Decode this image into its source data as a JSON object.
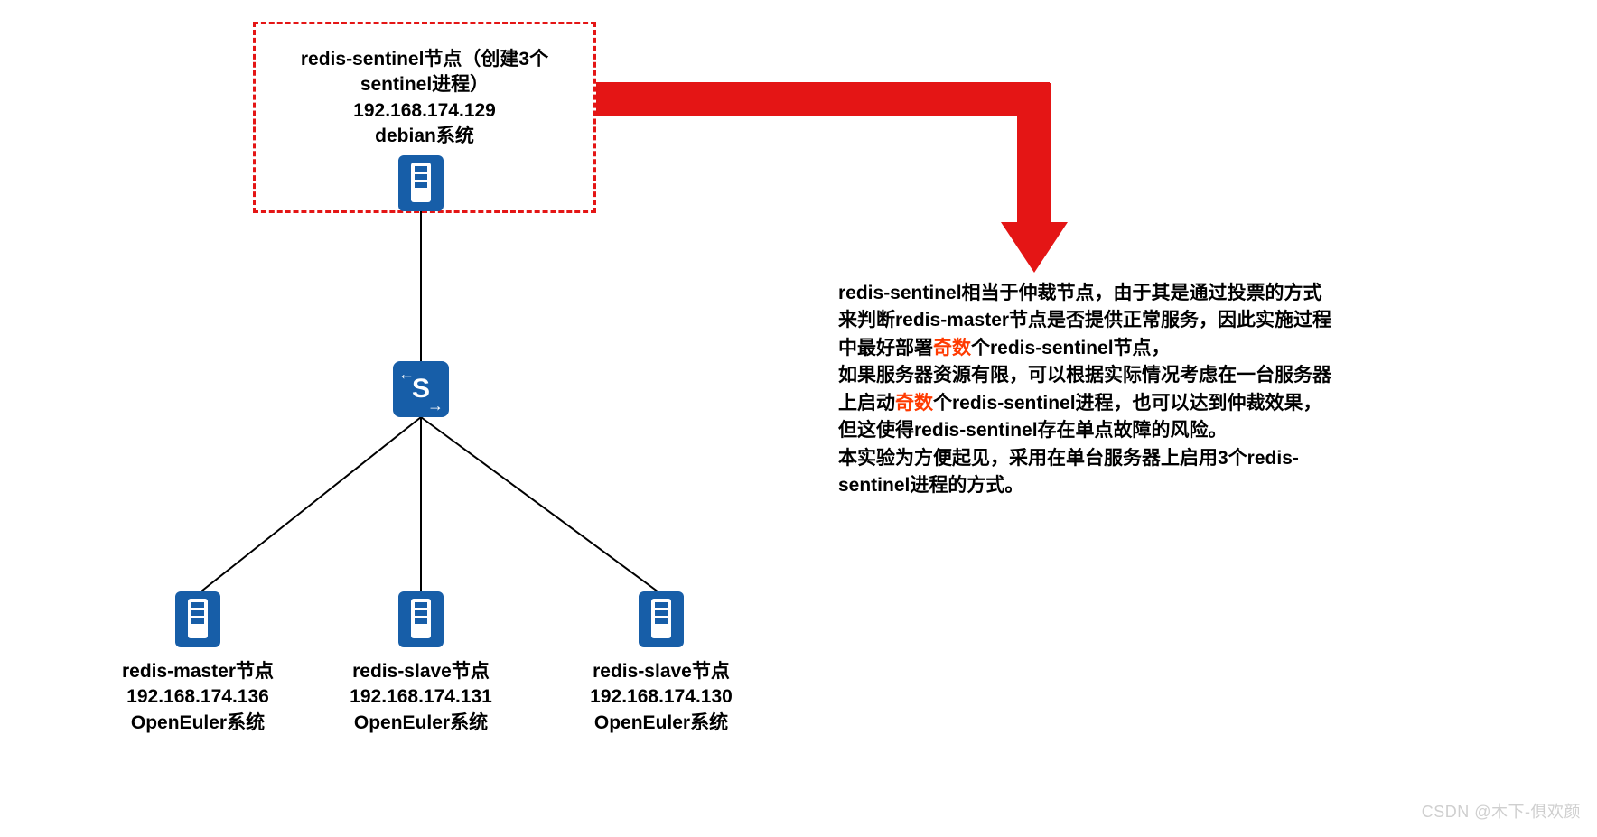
{
  "sentinel": {
    "title": "redis-sentinel节点（创建3个sentinel进程）",
    "ip": "192.168.174.129",
    "os": "debian系统"
  },
  "master": {
    "title": "redis-master节点",
    "ip": "192.168.174.136",
    "os": "OpenEuler系统"
  },
  "slave1": {
    "title": "redis-slave节点",
    "ip": "192.168.174.131",
    "os": "OpenEuler系统"
  },
  "slave2": {
    "title": "redis-slave节点",
    "ip": "192.168.174.130",
    "os": "OpenEuler系统"
  },
  "explain": {
    "p1a": "redis-sentinel相当于仲裁节点，由于其是通过投票的方式来判断redis-master节点是否提供正常服务，因此实施过程中最好部署",
    "odd1": "奇数",
    "p1b": "个redis-sentinel节点，",
    "p2a": "如果服务器资源有限，可以根据实际情况考虑在一台服务器上启动",
    "odd2": "奇数",
    "p2b": "个redis-sentinel进程，也可以达到仲裁效果，但这使得redis-sentinel存在单点故障的风险。",
    "p3": "本实验为方便起见，采用在单台服务器上启用3个redis-sentinel进程的方式。"
  },
  "switch_label": "S",
  "watermark": "CSDN @木下-俱欢颜"
}
